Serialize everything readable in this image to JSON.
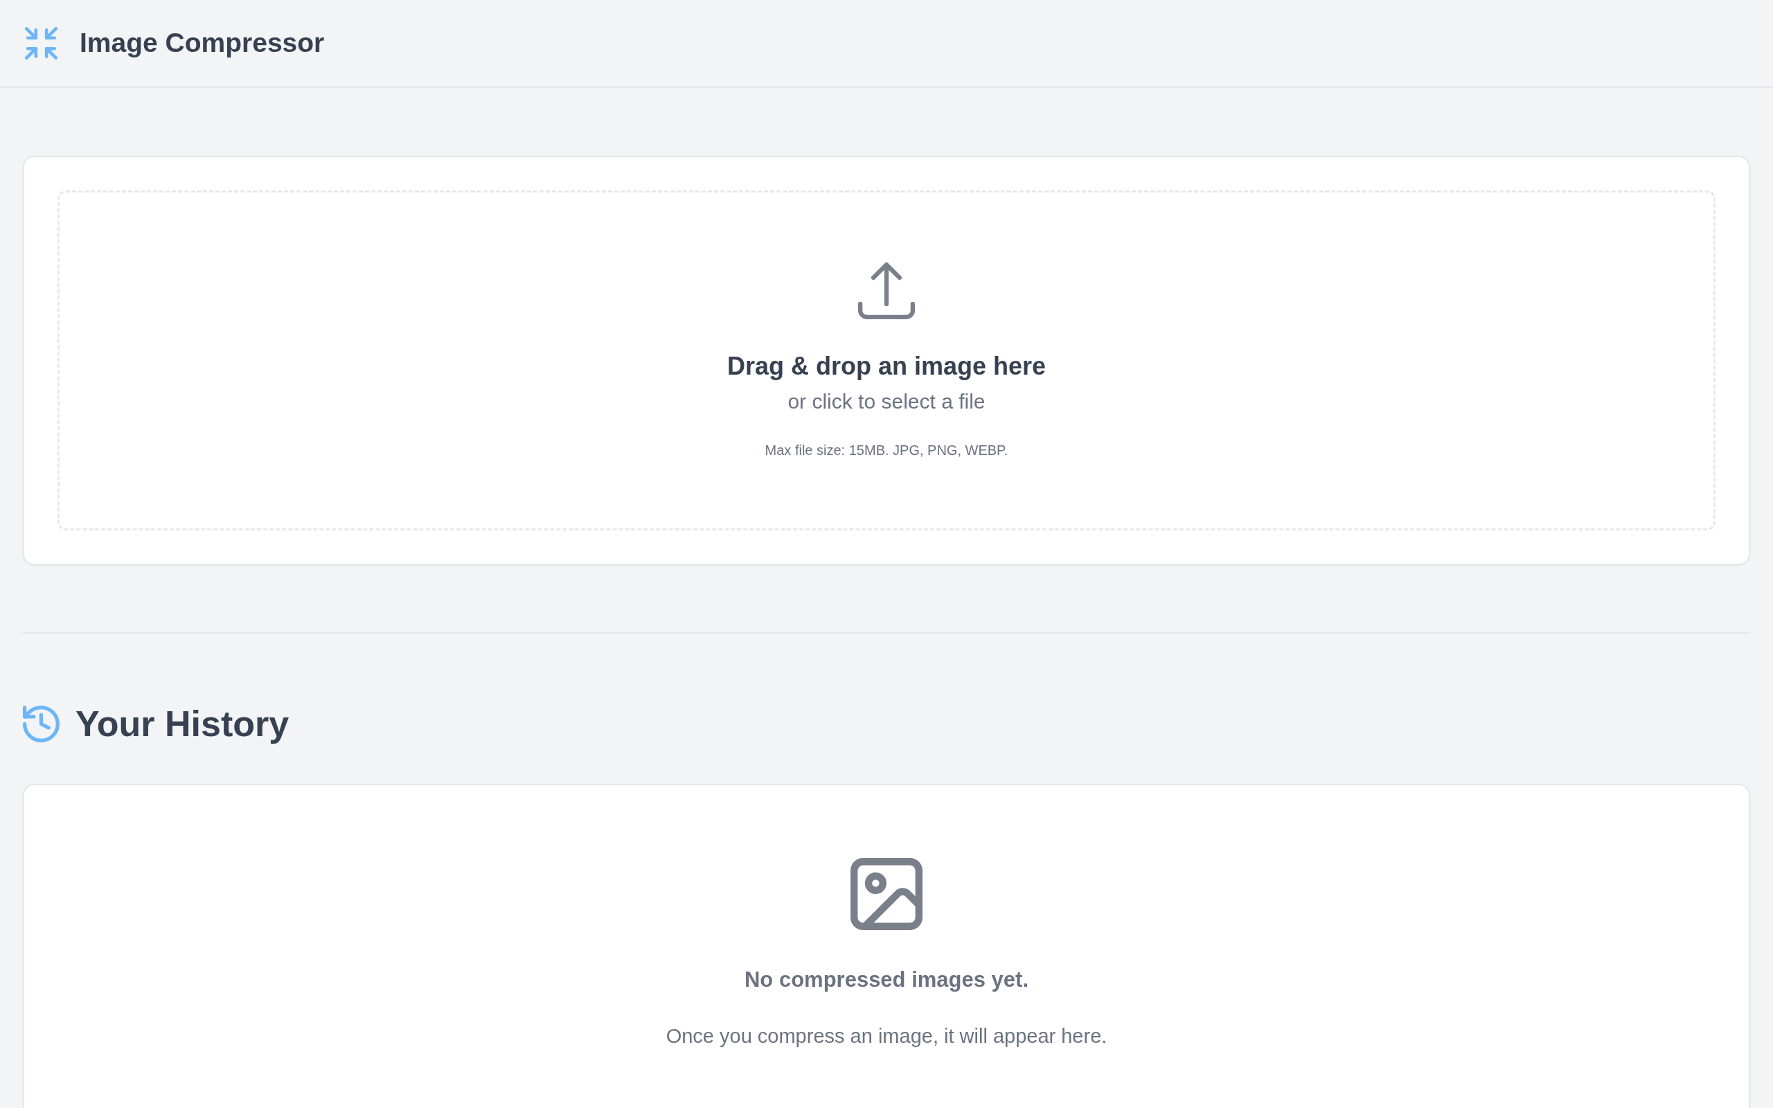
{
  "header": {
    "title": "Image Compressor"
  },
  "upload": {
    "heading": "Drag & drop an image here",
    "subtext": "or click to select a file",
    "hint": "Max file size: 15MB. JPG, PNG, WEBP."
  },
  "history": {
    "title": "Your History",
    "empty_title": "No compressed images yet.",
    "empty_message": "Once you compress an image, it will appear here."
  }
}
